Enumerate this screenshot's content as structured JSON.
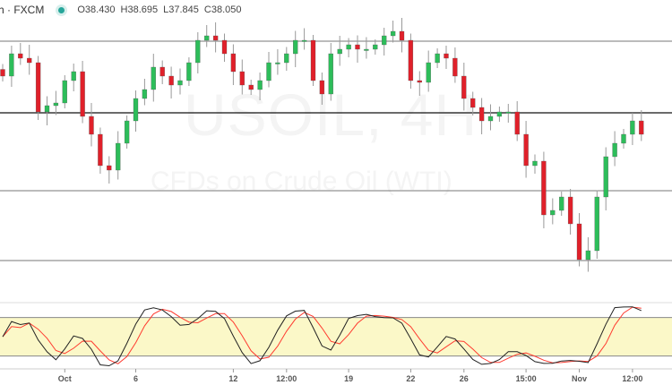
{
  "header": {
    "symbol": "h · FXCM",
    "open": "O38.430",
    "high": "H38.695",
    "low": "L37.845",
    "close": "C38.050"
  },
  "watermark": {
    "title": "USOIL, 4H",
    "subtitle": "CFDs on Crude Oil (WTI)"
  },
  "colors": {
    "up": "#2dbd5a",
    "down": "#e0202a",
    "stoch_k": "#222222",
    "stoch_d": "#ff3b30",
    "band": "#fbf8c8"
  },
  "chart_data": {
    "type": "candlestick",
    "title": "USOIL, 4H",
    "price_range": [
      34.25,
      41.05
    ],
    "closes": [
      39.35,
      39.85,
      39.75,
      39.65,
      38.55,
      38.69,
      38.75,
      39.25,
      39.45,
      38.45,
      38.05,
      37.35,
      37.25,
      37.85,
      38.35,
      38.85,
      39.05,
      39.55,
      39.35,
      39.15,
      39.25,
      39.65,
      40.15,
      40.25,
      40.15,
      39.85,
      39.45,
      39.15,
      39.05,
      39.25,
      39.65,
      39.65,
      39.85,
      40.15,
      40.15,
      39.25,
      38.95,
      39.85,
      39.95,
      40.05,
      39.95,
      39.95,
      40.05,
      40.25,
      40.35,
      40.15,
      39.25,
      39.21,
      39.65,
      39.85,
      39.75,
      39.35,
      38.85,
      38.65,
      38.35,
      38.45,
      38.55,
      38.55,
      38.05,
      37.35,
      37.45,
      36.25,
      36.35,
      36.65,
      36.05,
      35.25,
      35.45,
      36.65,
      37.55,
      37.85,
      38.05,
      38.35,
      38.05
    ],
    "horizontal_levels": [
      40.13,
      38.53,
      36.79,
      35.23
    ],
    "stochastic": {
      "upper": 80,
      "lower": 20
    },
    "x_ticks": [
      {
        "label": "Oct",
        "index": 7
      },
      {
        "label": "6",
        "index": 15
      },
      {
        "label": "12",
        "index": 26
      },
      {
        "label": "12:00",
        "index": 32
      },
      {
        "label": "19",
        "index": 39
      },
      {
        "label": "22",
        "index": 46
      },
      {
        "label": "26",
        "index": 52
      },
      {
        "label": "15:00",
        "index": 59
      },
      {
        "label": "Nov",
        "index": 65
      },
      {
        "label": "12:00",
        "index": 71
      }
    ]
  }
}
